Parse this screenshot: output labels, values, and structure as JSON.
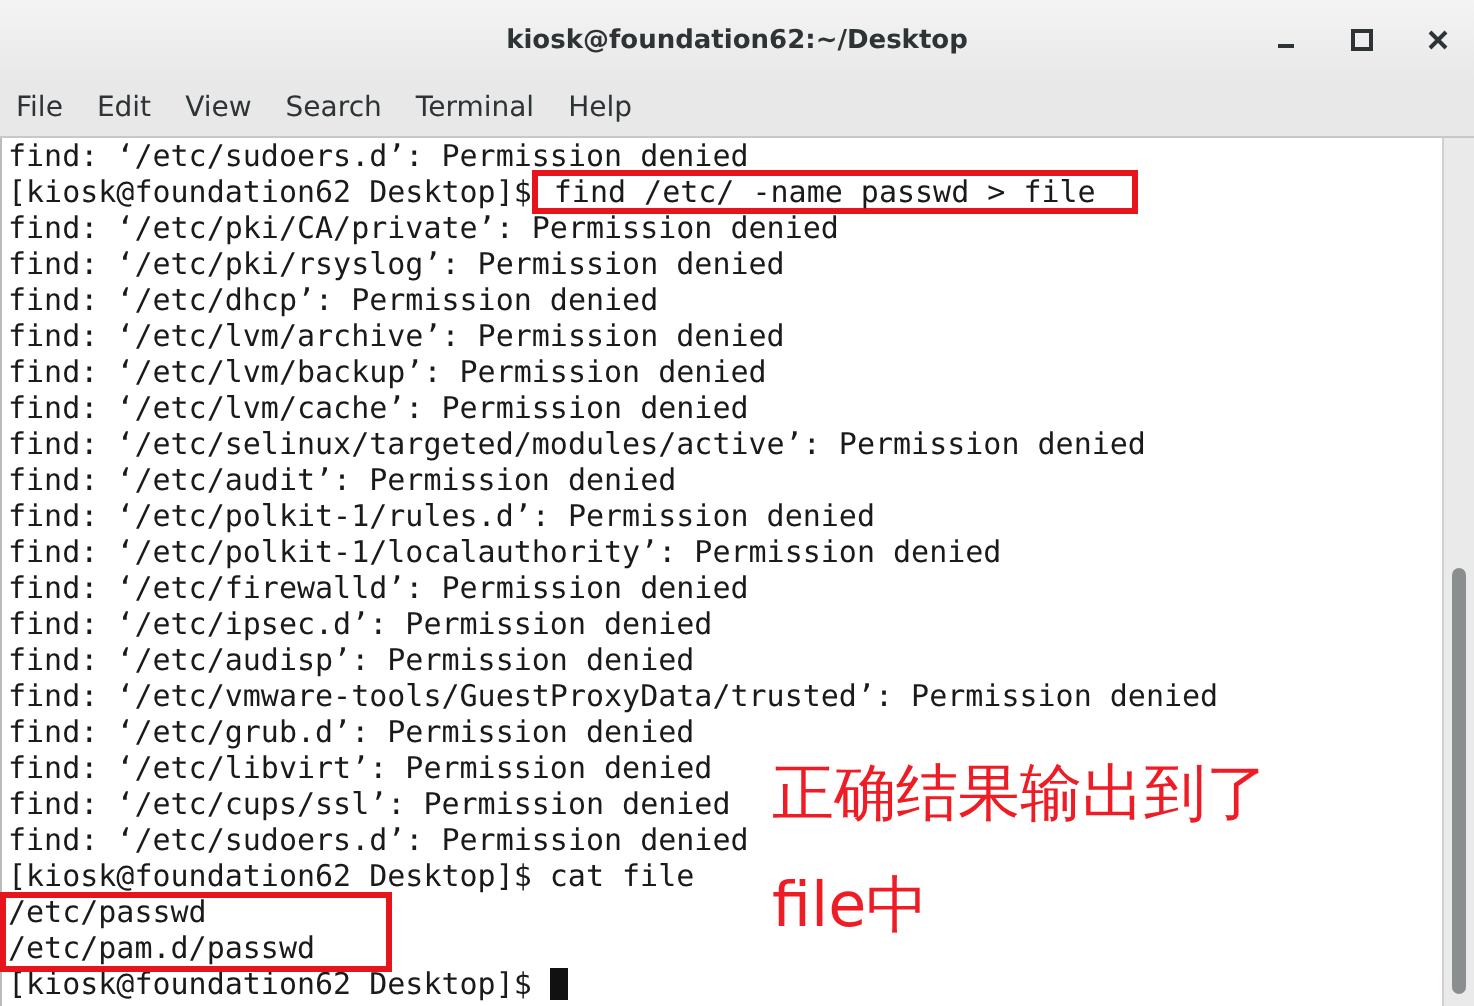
{
  "window": {
    "title": "kiosk@foundation62:~/Desktop"
  },
  "menu": [
    "File",
    "Edit",
    "View",
    "Search",
    "Terminal",
    "Help"
  ],
  "terminal": {
    "lines": [
      {
        "kind": "text",
        "text": "find: ‘/etc/sudoers.d’: Permission denied"
      },
      {
        "kind": "prompt",
        "prompt": "[kiosk@foundation62 Desktop]$",
        "command": "find /etc/ -name passwd > file",
        "highlighted": true
      },
      {
        "kind": "text",
        "text": "find: ‘/etc/pki/CA/private’: Permission denied"
      },
      {
        "kind": "text",
        "text": "find: ‘/etc/pki/rsyslog’: Permission denied"
      },
      {
        "kind": "text",
        "text": "find: ‘/etc/dhcp’: Permission denied"
      },
      {
        "kind": "text",
        "text": "find: ‘/etc/lvm/archive’: Permission denied"
      },
      {
        "kind": "text",
        "text": "find: ‘/etc/lvm/backup’: Permission denied"
      },
      {
        "kind": "text",
        "text": "find: ‘/etc/lvm/cache’: Permission denied"
      },
      {
        "kind": "text",
        "text": "find: ‘/etc/selinux/targeted/modules/active’: Permission denied"
      },
      {
        "kind": "text",
        "text": "find: ‘/etc/audit’: Permission denied"
      },
      {
        "kind": "text",
        "text": "find: ‘/etc/polkit-1/rules.d’: Permission denied"
      },
      {
        "kind": "text",
        "text": "find: ‘/etc/polkit-1/localauthority’: Permission denied"
      },
      {
        "kind": "text",
        "text": "find: ‘/etc/firewalld’: Permission denied"
      },
      {
        "kind": "text",
        "text": "find: ‘/etc/ipsec.d’: Permission denied"
      },
      {
        "kind": "text",
        "text": "find: ‘/etc/audisp’: Permission denied"
      },
      {
        "kind": "text",
        "text": "find: ‘/etc/vmware-tools/GuestProxyData/trusted’: Permission denied"
      },
      {
        "kind": "text",
        "text": "find: ‘/etc/grub.d’: Permission denied"
      },
      {
        "kind": "text",
        "text": "find: ‘/etc/libvirt’: Permission denied"
      },
      {
        "kind": "text",
        "text": "find: ‘/etc/cups/ssl’: Permission denied"
      },
      {
        "kind": "text",
        "text": "find: ‘/etc/sudoers.d’: Permission denied"
      },
      {
        "kind": "prompt",
        "prompt": "[kiosk@foundation62 Desktop]$",
        "command": "cat file",
        "highlighted": false
      },
      {
        "kind": "text",
        "text": "/etc/passwd"
      },
      {
        "kind": "text",
        "text": "/etc/pam.d/passwd"
      },
      {
        "kind": "prompt",
        "prompt": "[kiosk@foundation62 Desktop]$",
        "cursor": true
      }
    ]
  },
  "annotation": {
    "lines": [
      "正确结果输出到了",
      "file中"
    ]
  }
}
